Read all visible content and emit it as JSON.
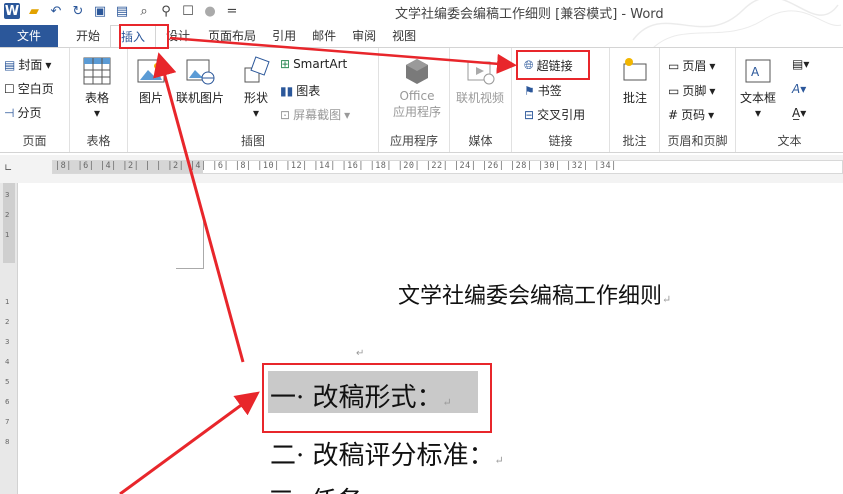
{
  "title_bar": {
    "title": "文学社编委会编稿工作细则 [兼容模式] - Word",
    "qat_items": [
      "W",
      "📂",
      "↶",
      "↻",
      "💾",
      "💾",
      "🔍",
      "🔭",
      "☐",
      "●",
      "="
    ]
  },
  "tabs": [
    "文件",
    "开始",
    "插入",
    "设计",
    "页面布局",
    "引用",
    "邮件",
    "审阅",
    "视图"
  ],
  "ribbon": {
    "pages": {
      "label": "页面",
      "items": [
        "封面",
        "空白页",
        "分页"
      ]
    },
    "table": {
      "label": "表格",
      "item": "表格"
    },
    "illustrations": {
      "label": "插图",
      "picture": "图片",
      "online_picture": "联机图片",
      "shapes": "形状",
      "smartart": "SmartArt",
      "chart": "图表",
      "screenshot": "屏幕截图"
    },
    "apps": {
      "label": "应用程序",
      "office": "Office",
      "office2": "应用程序"
    },
    "media": {
      "label": "媒体",
      "online_video": "联机视频"
    },
    "links": {
      "label": "链接",
      "hyperlink": "超链接",
      "bookmark": "书签",
      "crossref": "交叉引用"
    },
    "comments": {
      "label": "批注",
      "comment": "批注"
    },
    "header_footer": {
      "label": "页眉和页脚",
      "header": "页眉",
      "footer": "页脚",
      "page_number": "页码"
    },
    "text": {
      "label": "文本",
      "textbox": "文本框"
    }
  },
  "ruler": {
    "text": "|8|  |6|  |4|  |2|  |  |  |2|  |4|  |6|  |8|  |10|  |12|  |14|  |16|  |18|  |20|  |22|  |24|  |26|  |28|  |30|  |32|  |34|"
  },
  "vruler_ticks": [
    "3",
    "2",
    "1",
    "1",
    "2",
    "3",
    "4",
    "5",
    "6",
    "7",
    "8"
  ],
  "document": {
    "title": "文学社编委会编稿工作细则",
    "line1": "一· 改稿形式：",
    "line2": "二· 改稿评分标准：",
    "line3": "三· 任务"
  }
}
